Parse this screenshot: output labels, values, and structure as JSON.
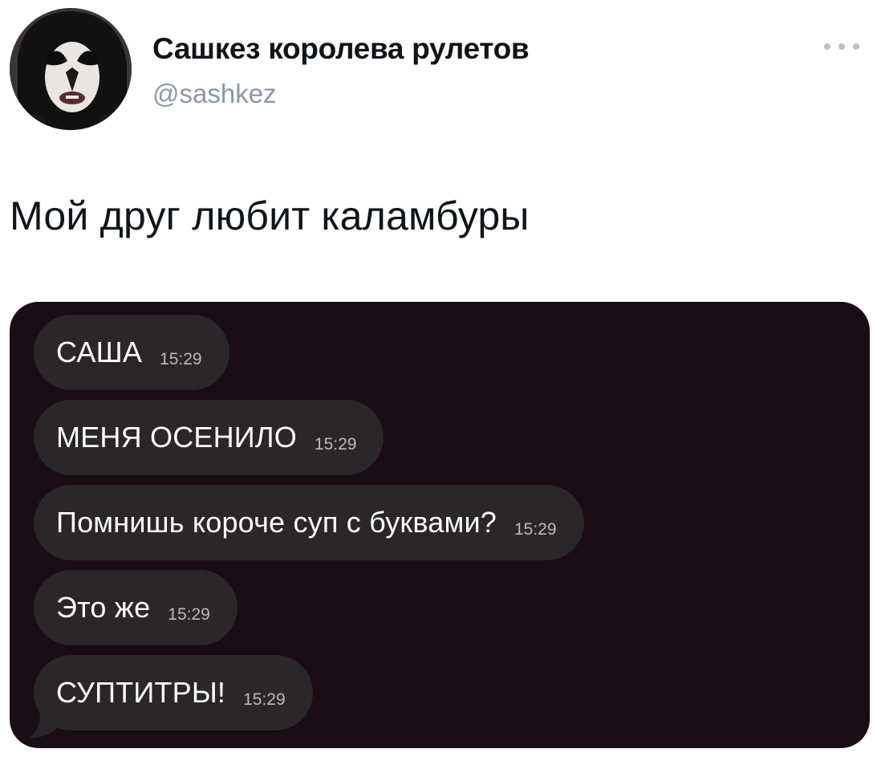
{
  "author": {
    "display_name": "Сашкез королева рулетов",
    "handle": "@sashkez"
  },
  "tweet": {
    "text": "Мой друг любит каламбуры"
  },
  "chat": {
    "messages": [
      {
        "text": "САША",
        "time": "15:29"
      },
      {
        "text": "МЕНЯ ОСЕНИЛО",
        "time": "15:29"
      },
      {
        "text": "Помнишь короче суп с буквами?",
        "time": "15:29"
      },
      {
        "text": "Это же",
        "time": "15:29"
      },
      {
        "text": "СУПТИТРЫ!",
        "time": "15:29"
      }
    ]
  },
  "icons": {
    "more": "more-horizontal-icon"
  },
  "colors": {
    "chat_background": "#1a0d16",
    "bubble": "#2a2629",
    "handle_text": "#8b98a5"
  }
}
